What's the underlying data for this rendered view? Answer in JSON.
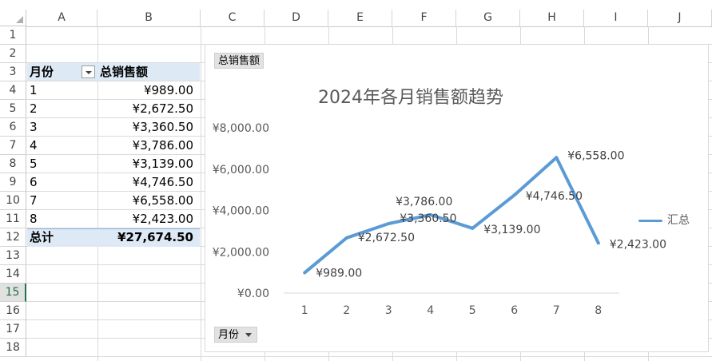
{
  "columns": [
    "A",
    "B",
    "C",
    "D",
    "E",
    "F",
    "G",
    "H",
    "I",
    "J"
  ],
  "rows": [
    "1",
    "2",
    "3",
    "4",
    "5",
    "6",
    "7",
    "8",
    "9",
    "10",
    "11",
    "12",
    "13",
    "14",
    "15",
    "16",
    "17",
    "18"
  ],
  "active_row": "15",
  "pivot": {
    "header_month": "月份",
    "header_total": "总销售额",
    "rows": [
      {
        "month": "1",
        "amount": "¥989.00"
      },
      {
        "month": "2",
        "amount": "¥2,672.50"
      },
      {
        "month": "3",
        "amount": "¥3,360.50"
      },
      {
        "month": "4",
        "amount": "¥3,786.00"
      },
      {
        "month": "5",
        "amount": "¥3,139.00"
      },
      {
        "month": "6",
        "amount": "¥4,746.50"
      },
      {
        "month": "7",
        "amount": "¥6,558.00"
      },
      {
        "month": "8",
        "amount": "¥2,423.00"
      }
    ],
    "total_label": "总计",
    "total_value": "¥27,674.50"
  },
  "chart_buttons": {
    "value_field": "总销售额",
    "axis_field": "月份"
  },
  "chart_data": {
    "type": "line",
    "title": "2024年各月销售额趋势",
    "categories": [
      "1",
      "2",
      "3",
      "4",
      "5",
      "6",
      "7",
      "8"
    ],
    "series": [
      {
        "name": "汇总",
        "values": [
          989.0,
          2672.5,
          3360.5,
          3786.0,
          3139.0,
          4746.5,
          6558.0,
          2423.0
        ],
        "color": "#5b9bd5"
      }
    ],
    "data_labels": [
      "¥989.00",
      "¥2,672.50",
      "¥3,360.50",
      "¥3,786.00",
      "¥3,139.00",
      "¥4,746.50",
      "¥6,558.00",
      "¥2,423.00"
    ],
    "y_ticks": [
      0,
      2000,
      4000,
      6000,
      8000
    ],
    "y_tick_labels": [
      "¥0.00",
      "¥2,000.00",
      "¥4,000.00",
      "¥6,000.00",
      "¥8,000.00"
    ],
    "ylim": [
      0,
      8000
    ],
    "grid": false,
    "legend_position": "right"
  }
}
